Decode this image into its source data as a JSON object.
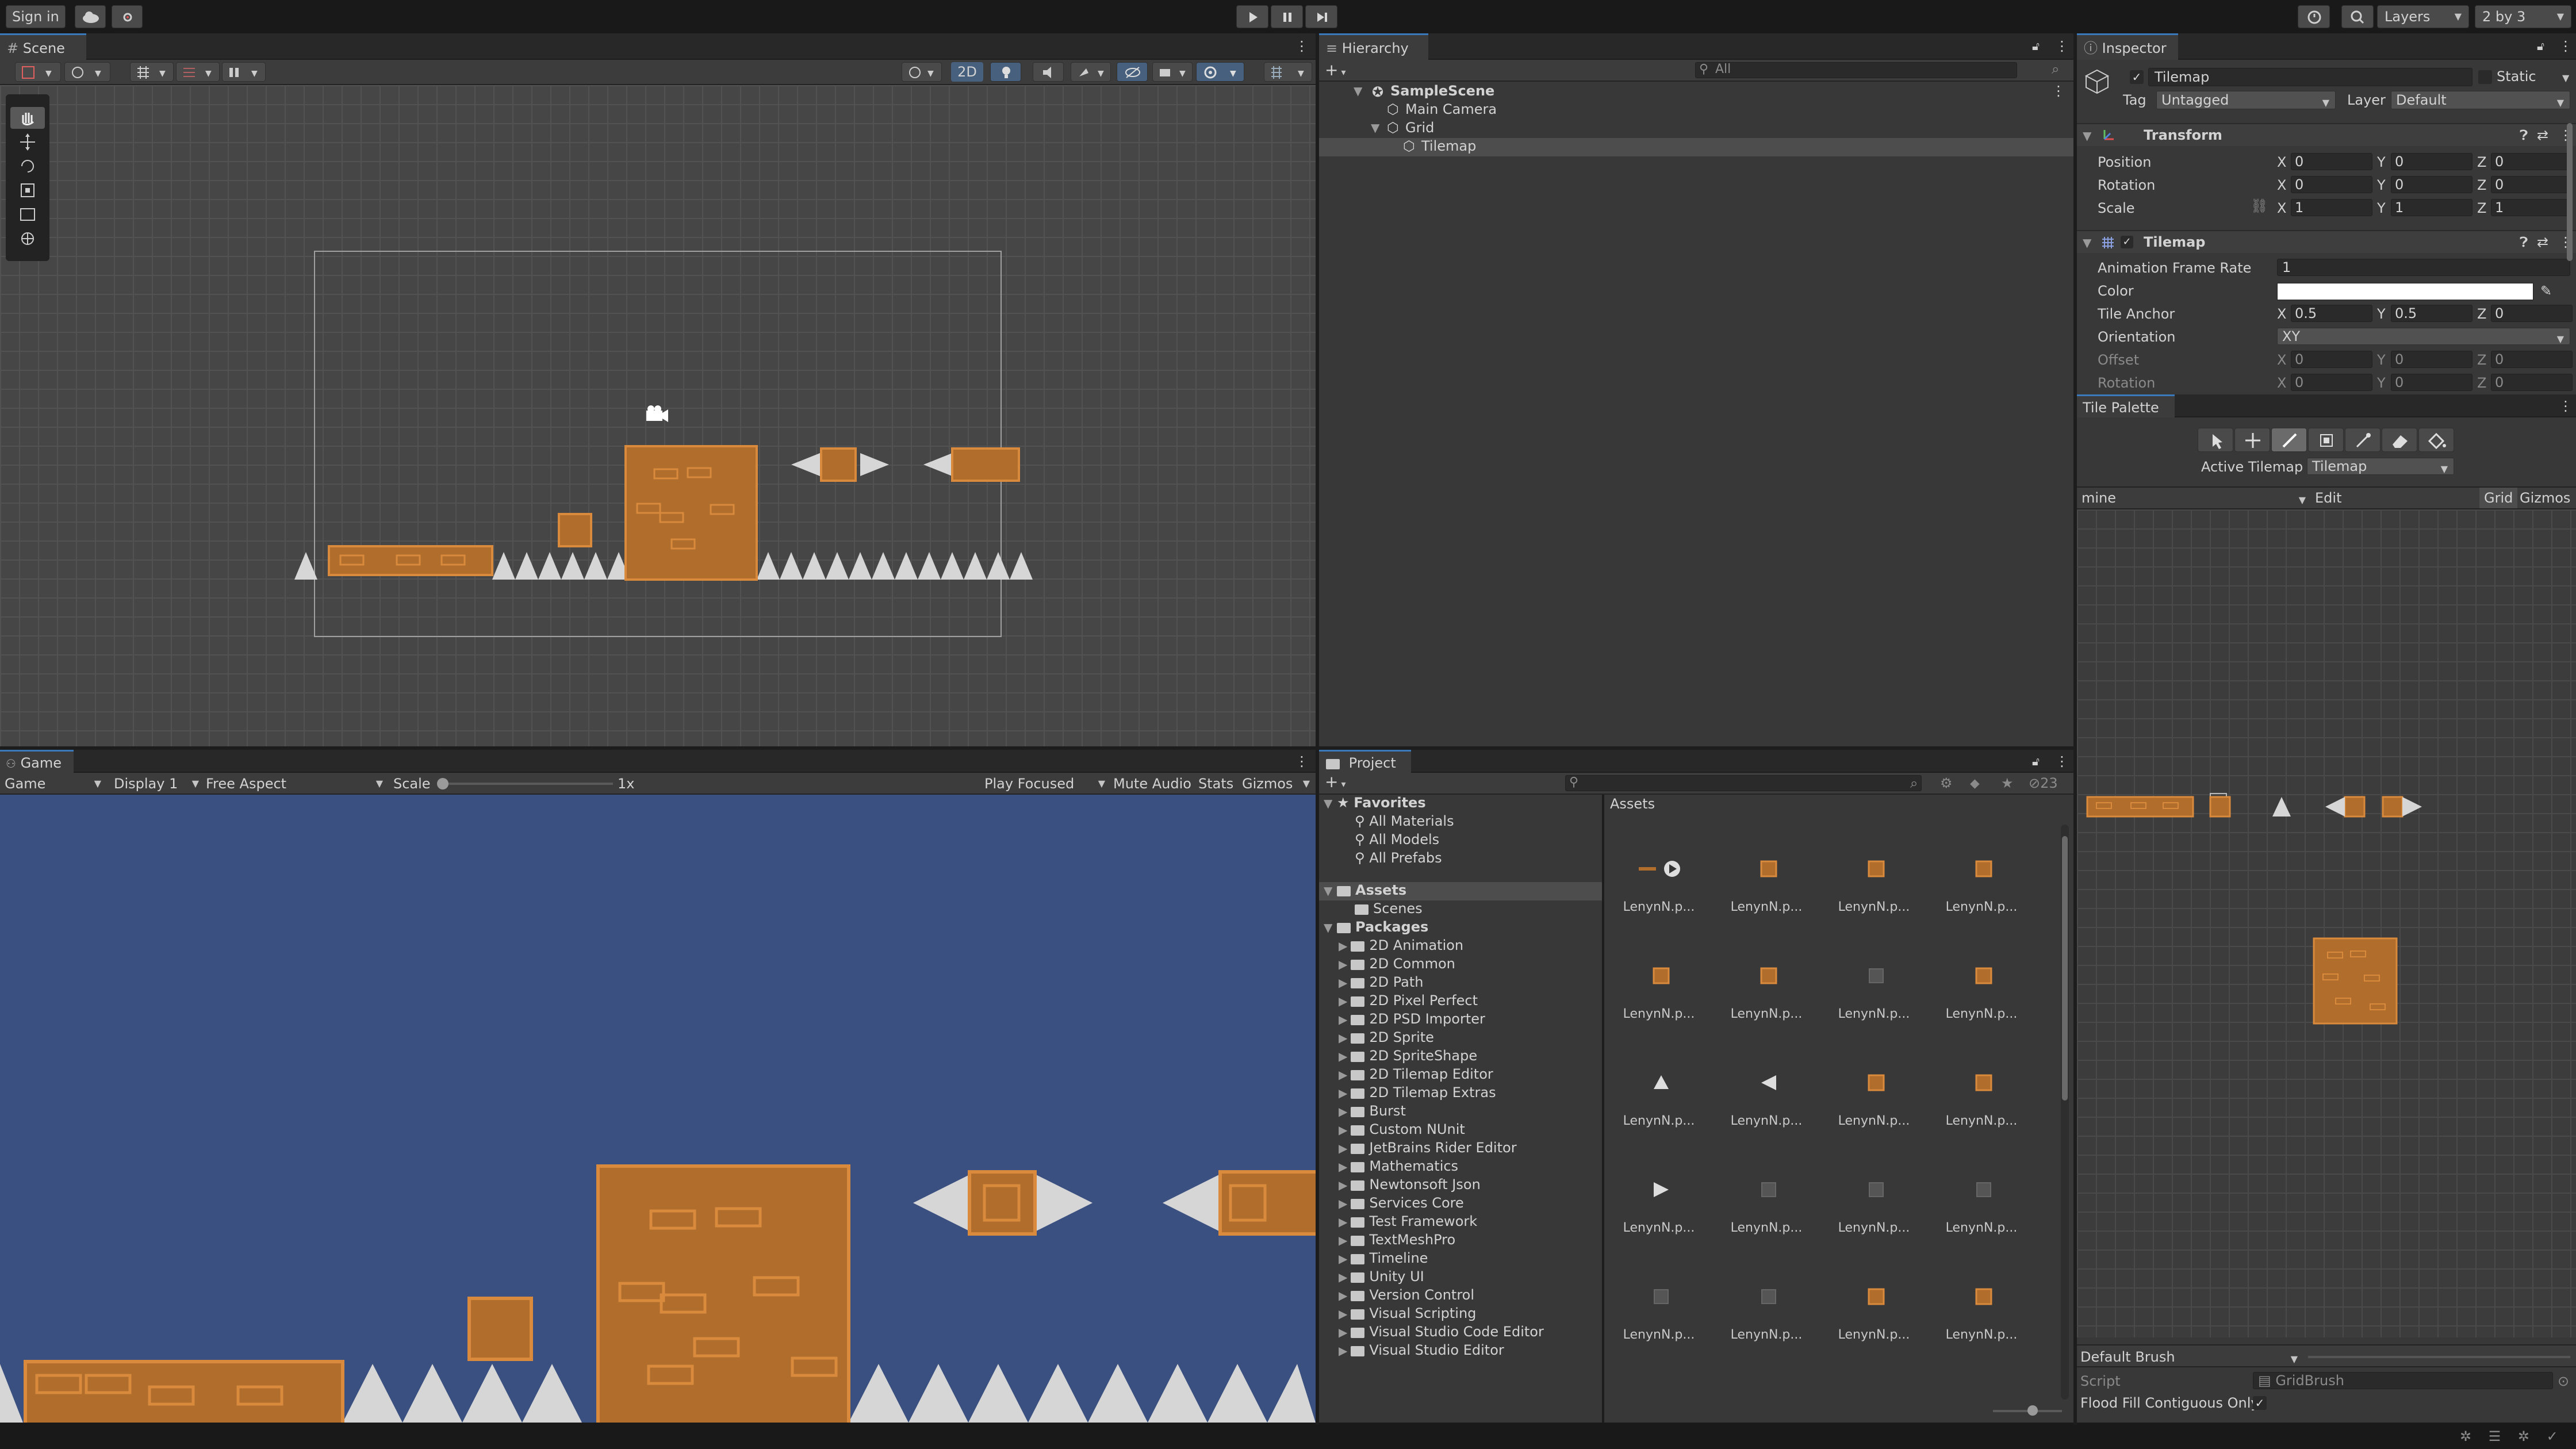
{
  "top_toolbar": {
    "sign_in": "Sign in",
    "layers": "Layers",
    "layout": "2 by 3"
  },
  "scene": {
    "tab": "Scene",
    "toolbar_2d": "2D"
  },
  "game": {
    "tab": "Game",
    "mode": "Game",
    "display": "Display 1",
    "aspect": "Free Aspect",
    "scale_label": "Scale",
    "scale_value": "1x",
    "play_focused": "Play Focused",
    "mute_audio": "Mute Audio",
    "stats": "Stats",
    "gizmos": "Gizmos",
    "background_color": "#3a5080"
  },
  "hierarchy": {
    "tab": "Hierarchy",
    "search_placeholder": "All",
    "items": [
      {
        "label": "SampleScene",
        "indent": 0
      },
      {
        "label": "Main Camera",
        "indent": 1
      },
      {
        "label": "Grid",
        "indent": 1
      },
      {
        "label": "Tilemap",
        "indent": 2
      }
    ]
  },
  "project": {
    "tab": "Project",
    "hidden_count": "23",
    "assets_header": "Assets",
    "favorites": {
      "label": "Favorites",
      "items": [
        "All Materials",
        "All Models",
        "All Prefabs"
      ]
    },
    "assets": {
      "label": "Assets",
      "items": [
        "Scenes"
      ]
    },
    "packages": {
      "label": "Packages",
      "items": [
        "2D Animation",
        "2D Common",
        "2D Path",
        "2D Pixel Perfect",
        "2D PSD Importer",
        "2D Sprite",
        "2D SpriteShape",
        "2D Tilemap Editor",
        "2D Tilemap Extras",
        "Burst",
        "Custom NUnit",
        "JetBrains Rider Editor",
        "Mathematics",
        "Newtonsoft Json",
        "Services Core",
        "Test Framework",
        "TextMeshPro",
        "Timeline",
        "Unity UI",
        "Version Control",
        "Visual Scripting",
        "Visual Studio Code Editor",
        "Visual Studio Editor"
      ]
    },
    "asset_name": "LenynN.p..."
  },
  "inspector": {
    "tab": "Inspector",
    "object_name": "Tilemap",
    "static_label": "Static",
    "tag_label": "Tag",
    "tag_value": "Untagged",
    "layer_label": "Layer",
    "layer_value": "Default",
    "transform": {
      "title": "Transform",
      "position_label": "Position",
      "rotation_label": "Rotation",
      "scale_label": "Scale",
      "position": [
        "0",
        "0",
        "0"
      ],
      "rotation": [
        "0",
        "0",
        "0"
      ],
      "scale": [
        "1",
        "1",
        "1"
      ]
    },
    "tilemap": {
      "title": "Tilemap",
      "frame_rate_label": "Animation Frame Rate",
      "frame_rate": "1",
      "color_label": "Color",
      "color_value": "#ffffff",
      "tile_anchor_label": "Tile Anchor",
      "tile_anchor": [
        "0.5",
        "0.5",
        "0"
      ],
      "orientation_label": "Orientation",
      "orientation": "XY",
      "offset_label": "Offset",
      "offset": [
        "0",
        "0",
        "0"
      ],
      "rotation_label": "Rotation",
      "rotation": [
        "0",
        "0",
        "0"
      ]
    },
    "axis": [
      "X",
      "Y",
      "Z"
    ]
  },
  "tile_palette": {
    "tab": "Tile Palette",
    "active_tilemap_label": "Active Tilemap",
    "active_tilemap": "Tilemap",
    "palette_name": "mine",
    "edit": "Edit",
    "grid": "Grid",
    "gizmos": "Gizmos",
    "brush": "Default Brush",
    "script_label": "Script",
    "script_value": "GridBrush",
    "flood_fill_label": "Flood Fill Contiguous Only"
  },
  "colors": {
    "tile_brown": "#b06d2c",
    "tile_border": "#d98a3c",
    "spike": "#d6d6d6",
    "accent": "#3a79bb"
  }
}
